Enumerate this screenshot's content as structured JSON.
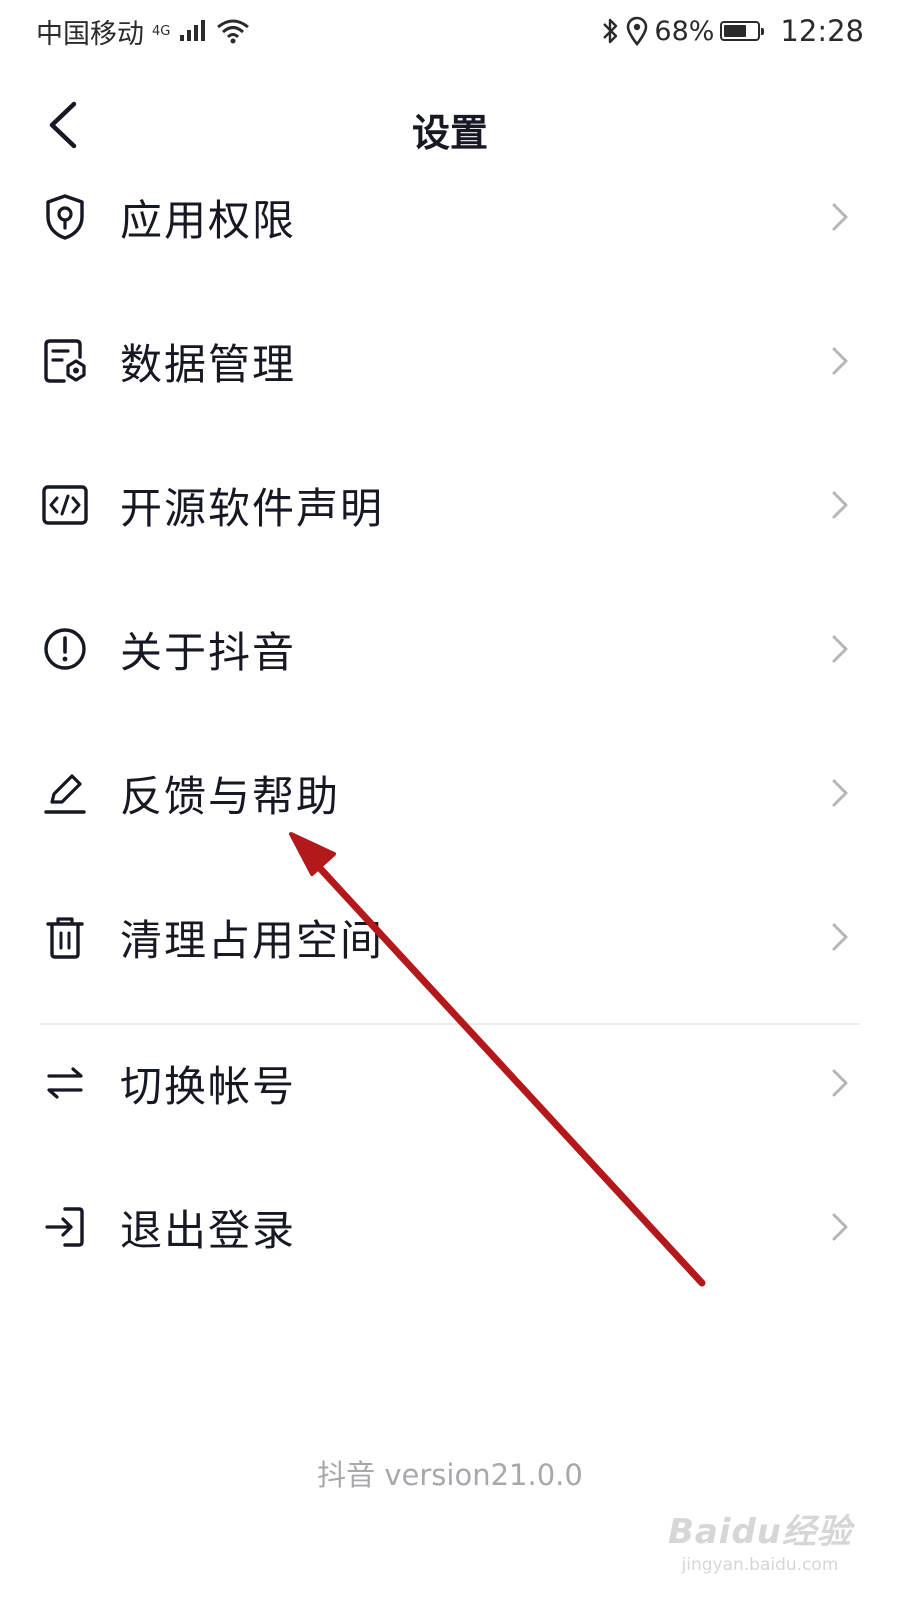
{
  "status_bar": {
    "carrier": "中国移动",
    "network": "4G",
    "battery": "68%",
    "battery_level": 0.68,
    "time": "12:28"
  },
  "header": {
    "title": "设置"
  },
  "menu": {
    "items": [
      {
        "label": "应用权限",
        "icon": "shield-key-icon"
      },
      {
        "label": "数据管理",
        "icon": "data-file-icon"
      },
      {
        "label": "开源软件声明",
        "icon": "code-icon"
      },
      {
        "label": "关于抖音",
        "icon": "info-circle-icon"
      },
      {
        "label": "反馈与帮助",
        "icon": "pen-icon"
      },
      {
        "label": "清理占用空间",
        "icon": "trash-icon"
      },
      {
        "label": "切换帐号",
        "icon": "switch-arrows-icon"
      },
      {
        "label": "退出登录",
        "icon": "logout-icon"
      }
    ]
  },
  "footer": {
    "version": "抖音 version21.0.0"
  },
  "watermark": {
    "main": "Baidu经验",
    "sub": "jingyan.baidu.com"
  },
  "colors": {
    "text": "#161823",
    "secondary": "#a7a8ad",
    "chevron": "#b5b6ba",
    "annotation_arrow": "#b3181b"
  }
}
